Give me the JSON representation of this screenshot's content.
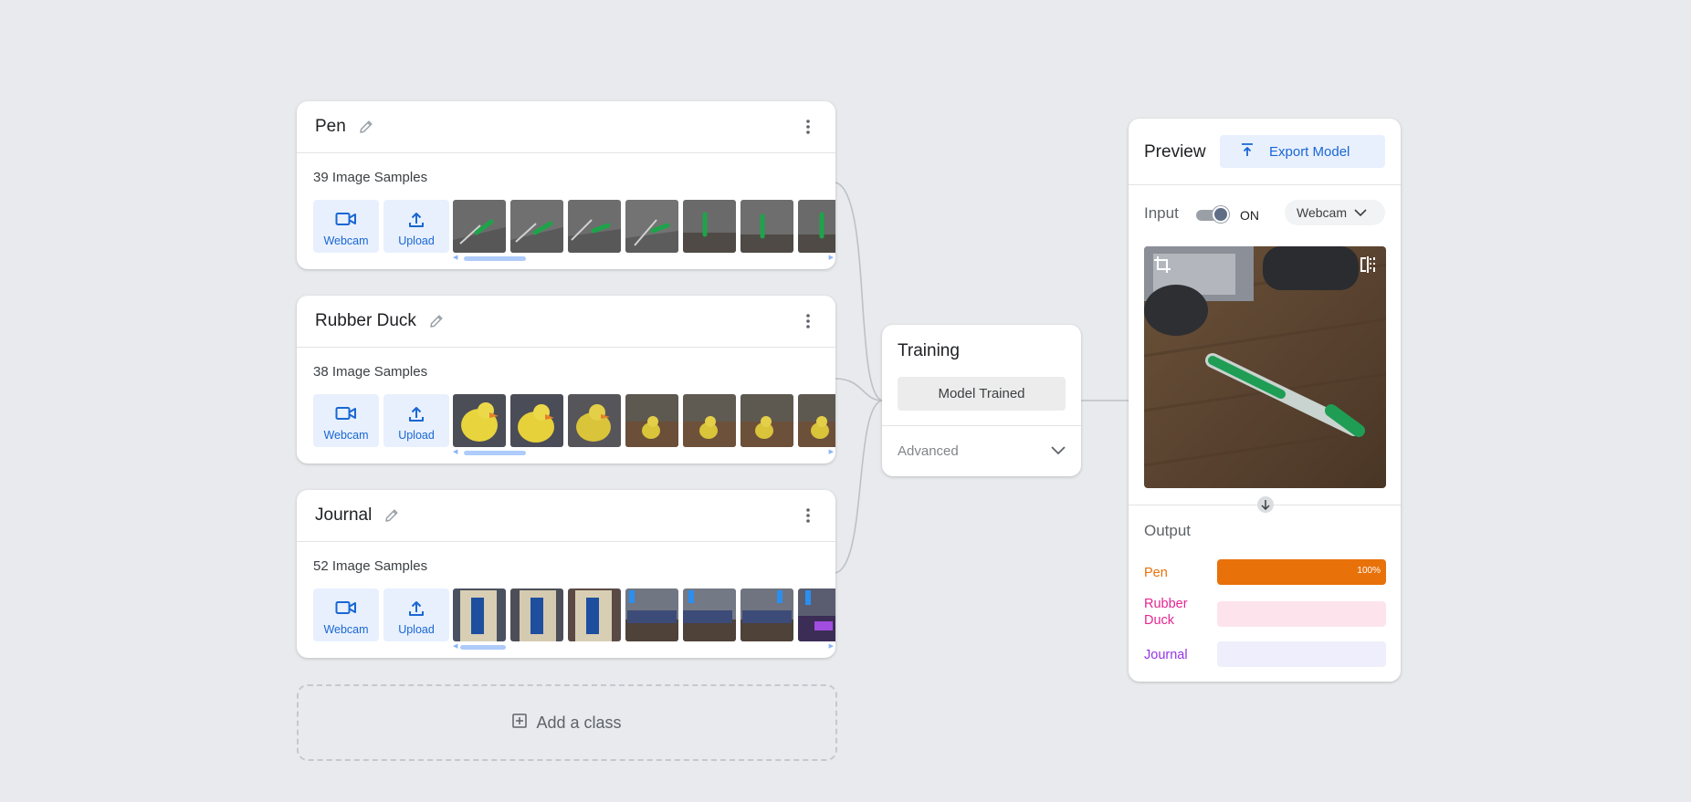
{
  "classes": [
    {
      "name": "Pen",
      "sample_count": "39 Image Samples",
      "webcam_label": "Webcam",
      "upload_label": "Upload",
      "thumb_kind": "pen"
    },
    {
      "name": "Rubber Duck",
      "sample_count": "38 Image Samples",
      "webcam_label": "Webcam",
      "upload_label": "Upload",
      "thumb_kind": "duck"
    },
    {
      "name": "Journal",
      "sample_count": "52 Image Samples",
      "webcam_label": "Webcam",
      "upload_label": "Upload",
      "thumb_kind": "journal"
    }
  ],
  "add_class_label": "Add a class",
  "training": {
    "title": "Training",
    "status_button": "Model Trained",
    "advanced_label": "Advanced"
  },
  "preview": {
    "title": "Preview",
    "export_label": "Export Model",
    "input_label": "Input",
    "toggle_state": "ON",
    "source_select": "Webcam",
    "output_label": "Output",
    "outputs": [
      {
        "name": "Pen",
        "value": 1.0,
        "percent_label": "100%",
        "color": "#e8710a",
        "track": "#fde3cf"
      },
      {
        "name": "Rubber Duck",
        "value": 0.0,
        "percent_label": "",
        "color": "#e52592",
        "track": "#fde4ec"
      },
      {
        "name": "Journal",
        "value": 0.0,
        "percent_label": "",
        "color": "#9334e6",
        "track": "#eeeefc"
      }
    ]
  },
  "colors": {
    "accent": "#1967d2",
    "accent_bg": "#e8f0fe",
    "background": "#e8eaed"
  }
}
